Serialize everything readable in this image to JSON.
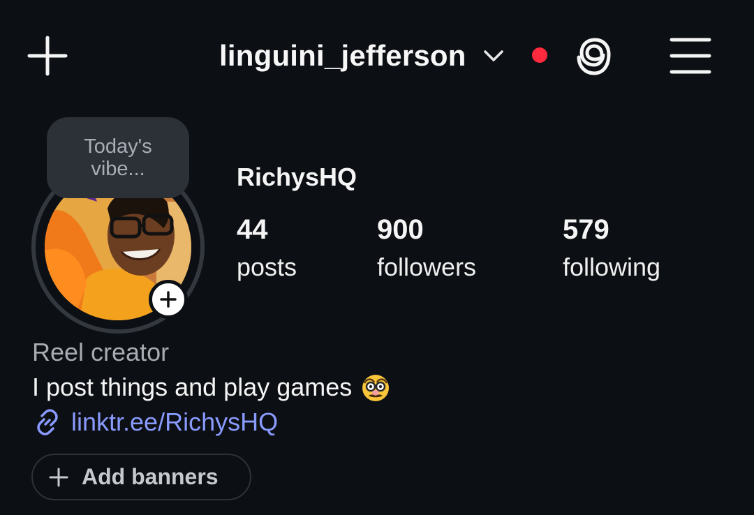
{
  "header": {
    "username": "linguini_jefferson",
    "notification_color": "#ff2a3d",
    "icons": {
      "create": "plus-icon",
      "switch_account": "chevron-down-icon",
      "threads": "threads-icon",
      "menu": "hamburger-menu-icon"
    }
  },
  "profile": {
    "note": {
      "line1": "Today's",
      "line2": "vibe..."
    },
    "display_name": "RichysHQ",
    "stats": {
      "posts": {
        "value": "44",
        "label": "posts"
      },
      "followers": {
        "value": "900",
        "label": "followers"
      },
      "following": {
        "value": "579",
        "label": "following"
      }
    },
    "category": "Reel creator",
    "bio": "I post things and play games",
    "bio_emoji": "disguised-face-emoji",
    "link": "linktr.ee/RichysHQ",
    "link_color": "#8a9bff"
  },
  "actions": {
    "add_banners": "Add banners"
  }
}
